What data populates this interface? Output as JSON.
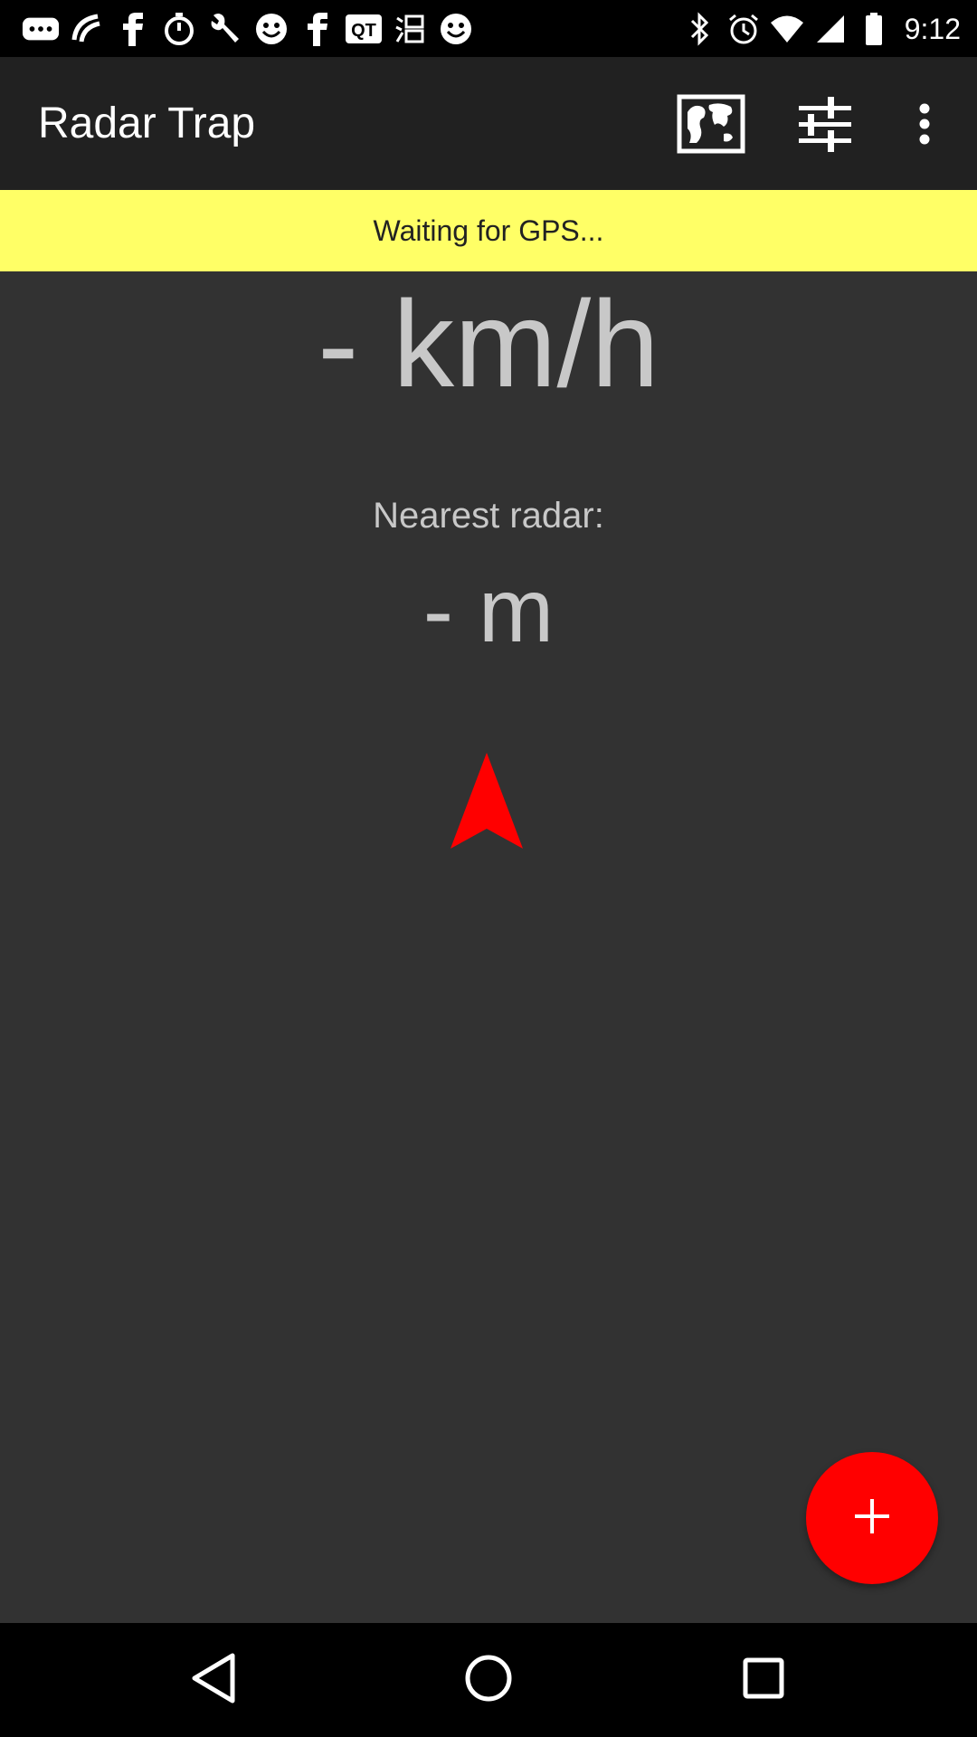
{
  "status_bar": {
    "time": "9:12",
    "left_icons": [
      "more-dots-icon",
      "rainbow-icon",
      "facebook-icon",
      "timer-icon",
      "wrench-icon",
      "smiley-icon",
      "facebook-icon",
      "qt-icon",
      "chinese-app-icon",
      "smiley-icon"
    ],
    "right_icons": [
      "bluetooth-icon",
      "alarm-icon",
      "wifi-icon",
      "signal-icon",
      "battery-icon"
    ]
  },
  "toolbar": {
    "title": "Radar Trap",
    "actions": [
      "map-icon",
      "sliders-icon",
      "overflow-menu-icon"
    ]
  },
  "gps_banner": {
    "text": "Waiting for GPS..."
  },
  "main": {
    "speed": "- km/h",
    "nearest_label": "Nearest radar:",
    "distance": "- m",
    "arrow_color": "#ff0000"
  },
  "fab": {
    "icon": "plus-icon",
    "color": "#ff0000"
  },
  "nav_bar": {
    "buttons": [
      "back-icon",
      "home-icon",
      "recents-icon"
    ]
  },
  "colors": {
    "background": "#323232",
    "toolbar": "#212121",
    "banner": "#ffff66",
    "accent": "#ff0000"
  }
}
